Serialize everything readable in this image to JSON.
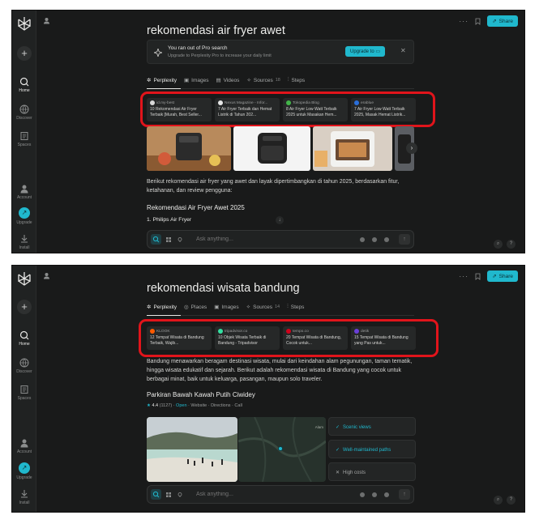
{
  "screens": [
    {
      "title": "rekomendasi air fryer awet",
      "sidebar": {
        "home": "Home",
        "discover": "Discover",
        "spaces": "Spaces",
        "account": "Account",
        "upgrade": "Upgrade",
        "install": "Install"
      },
      "top": {
        "share": "Share"
      },
      "banner": {
        "line1": "You ran out of Pro search",
        "line2": "Upgrade to Perplexity Pro to increase your daily limit",
        "button": "Upgrade to"
      },
      "tabs": [
        {
          "label": "Perplexity",
          "count": ""
        },
        {
          "label": "Images",
          "count": ""
        },
        {
          "label": "Videos",
          "count": ""
        },
        {
          "label": "Sources",
          "count": "18"
        },
        {
          "label": "Steps",
          "count": ""
        }
      ],
      "sources": [
        {
          "site": "id.my-best",
          "title": "10 Rekomendasi Air Fryer Terbaik [Murah, Best Seller...",
          "fav": "#d9d9d9"
        },
        {
          "site": "Nexus Magazine - Infor...",
          "title": "7 Air Fryer Terbaik dan Hemat Listrik di Tahun 202...",
          "fav": "#e6e6e6"
        },
        {
          "site": "Tokopedia Blog",
          "title": "8 Air Fryer Low Watt Terbaik 2025 untuk Masakan Hem...",
          "fav": "#42b549"
        },
        {
          "site": "erablue",
          "title": "7 Air Fryer Low Watt Terbaik 2025, Masak Hemat Listrik...",
          "fav": "#2a6fdb"
        }
      ],
      "paragraph": "Berikut rekomendasi air fryer yang awet dan layak dipertimbangkan di tahun 2025, berdasarkan fitur, ketahanan, dan review pengguna:",
      "heading": "Rekomendasi Air Fryer Awet 2025",
      "subheading": "1. Philips Air Fryer",
      "input_placeholder": "Ask anything..."
    },
    {
      "title": "rekomendasi wisata bandung",
      "sidebar": {
        "home": "Home",
        "discover": "Discover",
        "spaces": "Spaces",
        "account": "Account",
        "upgrade": "Upgrade",
        "install": "Install"
      },
      "top": {
        "share": "Share"
      },
      "tabs": [
        {
          "label": "Perplexity",
          "count": ""
        },
        {
          "label": "Places",
          "count": ""
        },
        {
          "label": "Images",
          "count": ""
        },
        {
          "label": "Sources",
          "count": "14"
        },
        {
          "label": "Steps",
          "count": ""
        }
      ],
      "sources": [
        {
          "site": "KLOOK",
          "title": "12 Tempat Wisata di Bandung Terbaik, Wajib...",
          "fav": "#ff5b00"
        },
        {
          "site": "tripadvisor.co",
          "title": "10 Objek Wisata Terbaik di Bandung - Tripadvisor",
          "fav": "#34e0a1"
        },
        {
          "site": "tempo.co",
          "title": "20 Tempat Wisata di Bandung, Cocok untuk...",
          "fav": "#d0021b"
        },
        {
          "site": "detik",
          "title": "15 Tempat Wisata di Bandung yang Pas untuk...",
          "fav": "#6a3fd8"
        }
      ],
      "paragraph": "Bandung menawarkan beragam destinasi wisata, mulai dari keindahan alam pegunungan, taman tematik, hingga wisata edukatif dan sejarah. Berikut adalah rekomendasi wisata di Bandung yang cocok untuk berbagai minat, baik untuk keluarga, pasangan, maupun solo traveler.",
      "place": {
        "name": "Parkiran Bawah Kawah Putih Ciwidey",
        "rating": "4.4",
        "reviews": "(1127)",
        "open": "Open",
        "website": "Website",
        "directions": "Directions",
        "call": "Call",
        "map_label": "Alam"
      },
      "features": [
        {
          "mark": "✓",
          "text": "Scenic views"
        },
        {
          "mark": "✓",
          "text": "Well-maintained paths"
        },
        {
          "mark": "✕",
          "text": "High costs"
        }
      ],
      "input_placeholder": "Ask anything..."
    }
  ],
  "colors": {
    "accent": "#20b8cd",
    "highlight": "#e1141b",
    "background": "#191a1a",
    "sidebar": "#202222"
  },
  "icons": [
    "perplexity-logo",
    "new-thread-icon",
    "home-icon",
    "discover-icon",
    "spaces-icon",
    "account-icon",
    "upgrade-icon",
    "install-icon",
    "share-icon",
    "bookmark-icon",
    "more-icon",
    "search-mode-icon",
    "attach-icon",
    "mic-icon",
    "send-icon"
  ]
}
